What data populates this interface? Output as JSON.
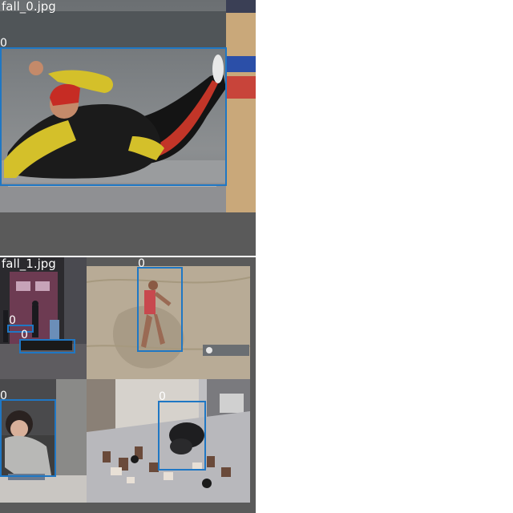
{
  "tiles": [
    {
      "filename": "fall_0.jpg",
      "detections": [
        {
          "class_id": "0"
        }
      ]
    },
    {
      "filename": "fall_1.jpg",
      "detections": [
        {
          "class_id": "0"
        },
        {
          "class_id": "0"
        },
        {
          "class_id": "0"
        },
        {
          "class_id": "0"
        },
        {
          "class_id": "0"
        }
      ]
    }
  ],
  "colors": {
    "bbox": "#1f77c4",
    "tile_background": "#5a5a5a",
    "label_text": "#ffffff"
  }
}
